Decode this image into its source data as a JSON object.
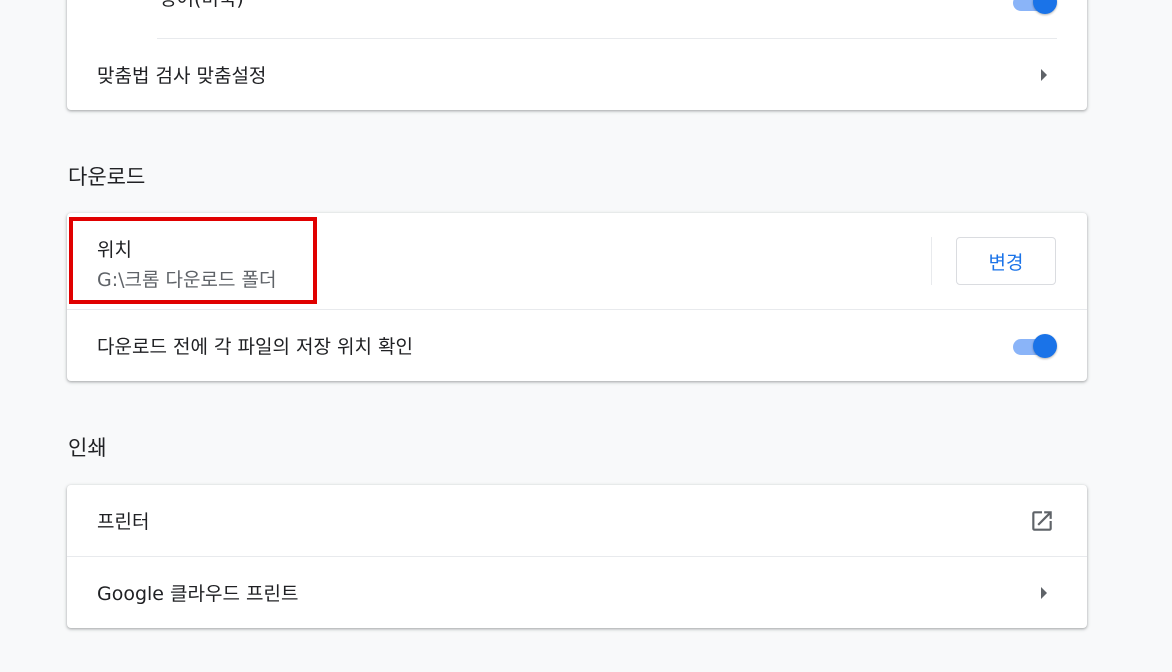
{
  "spellcheck_card": {
    "language_label": "영어(미국)",
    "custom_label": "맞춤법 검사 맞춤설정"
  },
  "downloads": {
    "section_title": "다운로드",
    "location_title": "위치",
    "location_path": "G:\\크롬 다운로드 폴더",
    "change_button": "변경",
    "ask_label": "다운로드 전에 각 파일의 저장 위치 확인"
  },
  "printing": {
    "section_title": "인쇄",
    "printers_label": "프린터",
    "cloud_print_label": "Google 클라우드 프린트"
  },
  "colors": {
    "accent": "#1a73e8",
    "highlight": "#e00000"
  },
  "states": {
    "language_toggle_on": true,
    "ask_toggle_on": true
  }
}
